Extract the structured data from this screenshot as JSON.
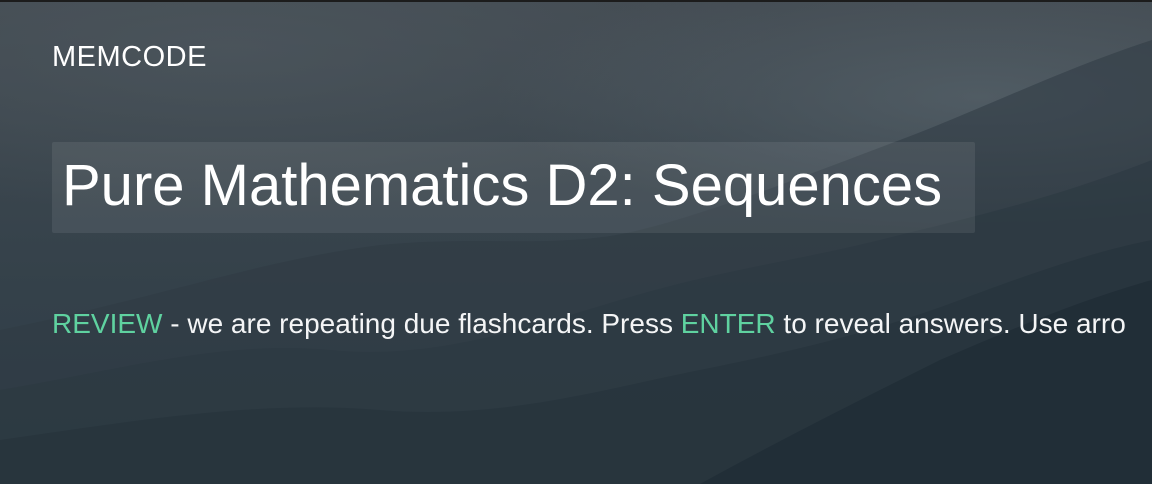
{
  "header": {
    "logo": "MEMCODE"
  },
  "course": {
    "title": "Pure Mathematics D2: Sequences"
  },
  "instructions": {
    "mode_label": "REVIEW",
    "text_1": " - we are repeating due flashcards. Press ",
    "key_label": "ENTER",
    "text_2": " to reveal answers. Use arro"
  },
  "colors": {
    "accent": "#5fd2a0",
    "text": "#ffffff",
    "background": "#39434b"
  }
}
